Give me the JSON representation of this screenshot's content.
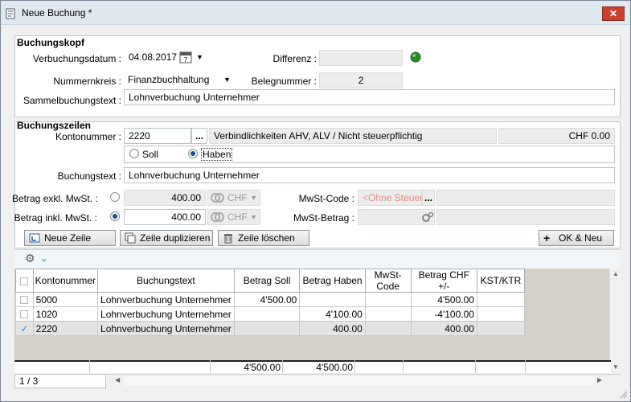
{
  "window": {
    "title": "Neue Buchung *",
    "close": "✕"
  },
  "kopf": {
    "header": "Buchungskopf",
    "verbuchungsdatum_label": "Verbuchungsdatum :",
    "verbuchungsdatum_value": "04.08.2017",
    "differenz_label": "Differenz :",
    "differenz_value": "",
    "nummernkreis_label": "Nummernkreis :",
    "nummernkreis_value": "Finanzbuchhaltung",
    "belegnummer_label": "Belegnummer :",
    "belegnummer_value": "2",
    "sammel_label": "Sammelbuchungstext :",
    "sammel_value": "Lohnverbuchung Unternehmer"
  },
  "zeilen": {
    "header": "Buchungszeilen",
    "konto_label": "Kontonummer :",
    "konto_value": "2220",
    "konto_browse": "...",
    "konto_desc": "Verbindlichkeiten AHV, ALV / Nicht steuerpflichtig",
    "konto_saldo": "CHF 0.00",
    "soll_label": "Soll",
    "haben_label": "Haben",
    "buchungstext_label": "Buchungstext :",
    "buchungstext_value": "Lohnverbuchung Unternehmer",
    "exkl_label": "Betrag exkl. MwSt. :",
    "exkl_value": "400.00",
    "inkl_label": "Betrag inkl. MwSt. :",
    "inkl_value": "400.00",
    "currency": "CHF",
    "mwst_code_label": "MwSt-Code :",
    "mwst_code_value": "<Ohne Steuer>",
    "mwst_browse": "...",
    "mwst_betrag_label": "MwSt-Betrag :"
  },
  "buttons": {
    "neue_zeile": "Neue Zeile",
    "duplizieren": "Zeile duplizieren",
    "loeschen": "Zeile löschen",
    "ok_neu": "OK & Neu"
  },
  "grid": {
    "columns": [
      "Kontonummer",
      "Buchungstext",
      "Betrag Soll",
      "Betrag Haben",
      "MwSt-Code",
      "Betrag CHF +/-",
      "KST/KTR"
    ],
    "rows": [
      {
        "konto": "5000",
        "text": "Lohnverbuchung Unternehmer",
        "soll": "4'500.00",
        "haben": "",
        "mwst": "",
        "betrag": "4'500.00",
        "kst": ""
      },
      {
        "konto": "1020",
        "text": "Lohnverbuchung Unternehmer",
        "soll": "",
        "haben": "4'100.00",
        "mwst": "",
        "betrag": "-4'100.00",
        "kst": ""
      },
      {
        "konto": "2220",
        "text": "Lohnverbuchung Unternehmer",
        "soll": "",
        "haben": "400.00",
        "mwst": "",
        "betrag": "400.00",
        "kst": ""
      }
    ],
    "total_soll": "4'500.00",
    "total_haben": "4'500.00",
    "pager": "1 / 3"
  },
  "colors": {
    "titlebar": "#dfe7ef",
    "close": "#c84031",
    "status_green": "#2e8b2e",
    "placeholder": "#e38b8b"
  }
}
